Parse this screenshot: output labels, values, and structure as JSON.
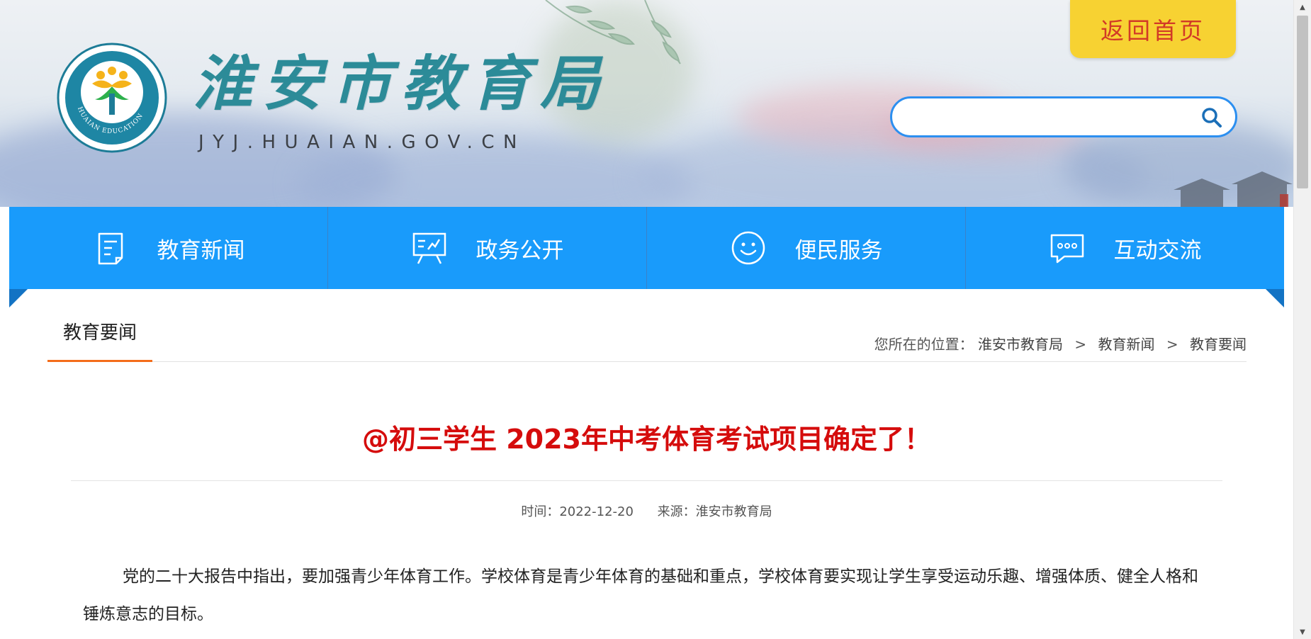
{
  "header": {
    "site_title": "淮安市教育局",
    "domain": "JYJ.HUAIAN.GOV.CN",
    "logo_text": "HUAIAN EDUCATION",
    "home_button": "返回首页",
    "search_placeholder": ""
  },
  "nav": {
    "items": [
      {
        "label": "教育新闻",
        "icon": "document-icon"
      },
      {
        "label": "政务公开",
        "icon": "presentation-icon"
      },
      {
        "label": "便民服务",
        "icon": "smiley-icon"
      },
      {
        "label": "互动交流",
        "icon": "chat-bubble-icon"
      }
    ]
  },
  "section": {
    "title": "教育要闻",
    "breadcrumb_prefix": "您所在的位置：",
    "breadcrumb": [
      "淮安市教育局",
      "教育新闻",
      "教育要闻"
    ],
    "separator": ">"
  },
  "article": {
    "title": "@初三学生 2023年中考体育考试项目确定了！",
    "time_label": "时间：2022-12-20",
    "source_label": "来源：淮安市教育局",
    "paragraph": "党的二十大报告中指出，要加强青少年体育工作。学校体育是青少年体育的基础和重点，学校体育要实现让学生享受运动乐趣、增强体质、健全人格和锤炼意志的目标。"
  },
  "colors": {
    "nav_blue": "#199bfb",
    "title_red": "#d50c0c",
    "home_button_bg": "#f7d232",
    "home_button_text": "#d23a27",
    "section_underline": "#f46d1b",
    "site_title": "#2c8b98"
  }
}
